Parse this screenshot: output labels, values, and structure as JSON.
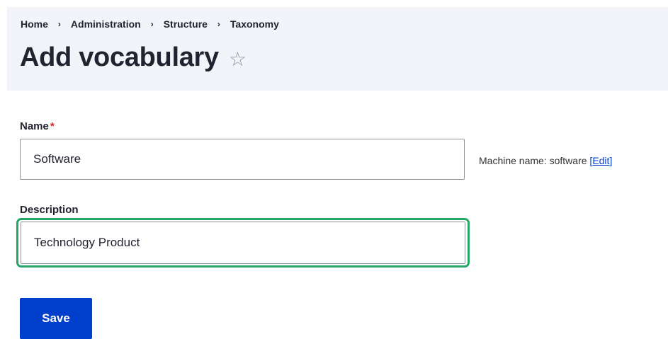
{
  "breadcrumb": {
    "items": [
      "Home",
      "Administration",
      "Structure",
      "Taxonomy"
    ],
    "separator": "›"
  },
  "page": {
    "title": "Add vocabulary",
    "star_icon": "☆"
  },
  "form": {
    "name": {
      "label": "Name",
      "required_mark": "*",
      "value": "Software"
    },
    "machine_name": {
      "prefix": "Machine name: software",
      "edit_open": "[",
      "edit_label": "Edit",
      "edit_close": "]"
    },
    "description": {
      "label": "Description",
      "value": "Technology Product"
    },
    "save_label": "Save"
  },
  "colors": {
    "accent": "#003ecc",
    "focus_ring": "#26a769",
    "required": "#dc2323",
    "header_bg": "#f3f4f9"
  }
}
